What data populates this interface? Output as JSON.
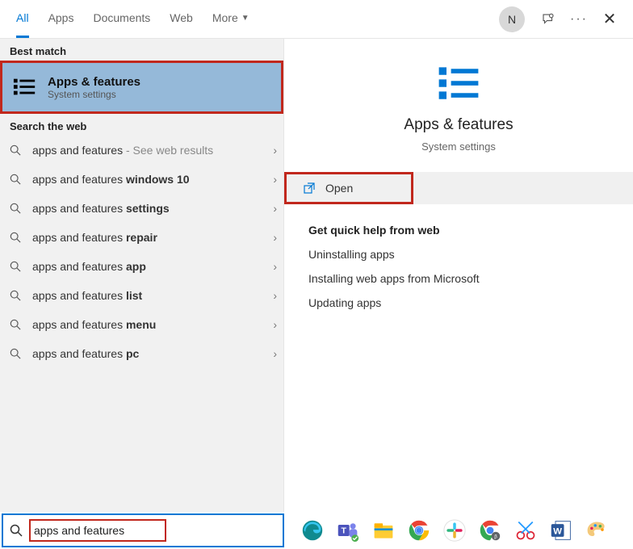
{
  "header": {
    "tabs": {
      "all": "All",
      "apps": "Apps",
      "documents": "Documents",
      "web": "Web",
      "more": "More"
    },
    "avatar_initial": "N"
  },
  "left": {
    "best_match_label": "Best match",
    "best_match": {
      "title": "Apps & features",
      "subtitle": "System settings"
    },
    "search_web_label": "Search the web",
    "web_results": [
      {
        "prefix": "apps and features",
        "bold": "",
        "extra": " - See web results"
      },
      {
        "prefix": "apps and features ",
        "bold": "windows 10",
        "extra": ""
      },
      {
        "prefix": "apps and features ",
        "bold": "settings",
        "extra": ""
      },
      {
        "prefix": "apps and features ",
        "bold": "repair",
        "extra": ""
      },
      {
        "prefix": "apps and features ",
        "bold": "app",
        "extra": ""
      },
      {
        "prefix": "apps and features ",
        "bold": "list",
        "extra": ""
      },
      {
        "prefix": "apps and features ",
        "bold": "menu",
        "extra": ""
      },
      {
        "prefix": "apps and features ",
        "bold": "pc",
        "extra": ""
      }
    ]
  },
  "right": {
    "title": "Apps & features",
    "subtitle": "System settings",
    "open_label": "Open",
    "help_title": "Get quick help from web",
    "help_links": {
      "uninstall": "Uninstalling apps",
      "install_web": "Installing web apps from Microsoft",
      "update": "Updating apps"
    }
  },
  "search": {
    "value": "apps and features"
  }
}
